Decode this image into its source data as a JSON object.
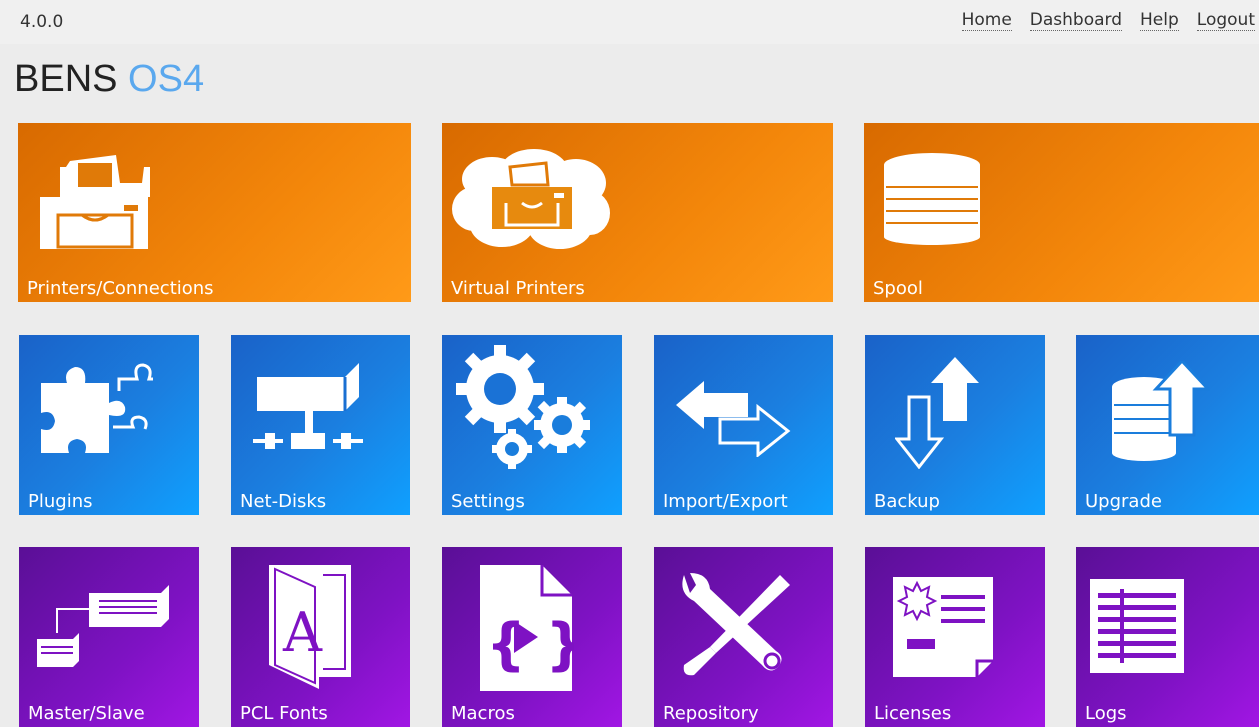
{
  "header": {
    "version": "4.0.0",
    "nav": [
      "Home",
      "Dashboard",
      "Help",
      "Logout"
    ]
  },
  "brand": {
    "part1": "BENS",
    "part2": "OS4"
  },
  "colors": {
    "orange": "#f3860a",
    "blue": "#1b7fe0",
    "purple": "#7e12c3",
    "brand_accent": "#5aa8ee"
  },
  "tiles": {
    "row1": [
      {
        "label": "Printers/Connections",
        "icon": "printer-icon"
      },
      {
        "label": "Virtual Printers",
        "icon": "cloud-printer-icon"
      },
      {
        "label": "Spool",
        "icon": "spool-stack-icon"
      }
    ],
    "row2": [
      {
        "label": "Plugins",
        "icon": "puzzle-icon"
      },
      {
        "label": "Net-Disks",
        "icon": "network-disk-icon"
      },
      {
        "label": "Settings",
        "icon": "gears-icon"
      },
      {
        "label": "Import/Export",
        "icon": "import-export-arrows-icon"
      },
      {
        "label": "Backup",
        "icon": "backup-arrows-icon"
      },
      {
        "label": "Upgrade",
        "icon": "upgrade-icon"
      }
    ],
    "row3": [
      {
        "label": "Master/Slave",
        "icon": "master-slave-icon"
      },
      {
        "label": "PCL Fonts",
        "icon": "font-book-icon"
      },
      {
        "label": "Macros",
        "icon": "macro-file-icon"
      },
      {
        "label": "Repository",
        "icon": "tools-icon"
      },
      {
        "label": "Licenses",
        "icon": "license-certificate-icon"
      },
      {
        "label": "Logs",
        "icon": "log-table-icon"
      }
    ]
  }
}
